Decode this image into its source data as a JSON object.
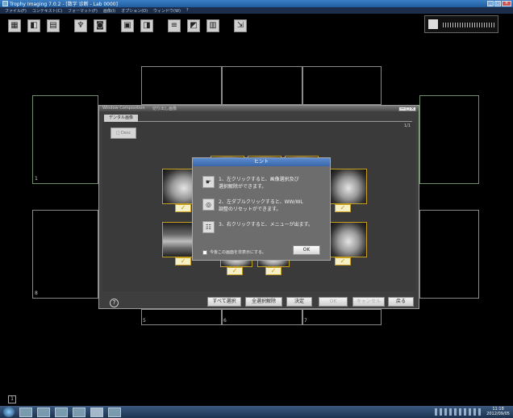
{
  "window": {
    "title": "Trophy Imaging 7.0.2 - [数字 诊断 - Lab 0000]",
    "controls": [
      "_",
      "□",
      "×"
    ]
  },
  "menu": [
    "ファイル(F)",
    "コンテキスト(C)",
    "フォーマット(F)",
    "画像(I)",
    "オプション(O)",
    "ウィンドウ(W)",
    "?"
  ],
  "toolbar_icons": [
    "layout-icon",
    "patient-icon",
    "folder-icon",
    "tooth-icon",
    "camera-icon",
    "xray-icon",
    "import-icon",
    "chart-icon",
    "export-icon",
    "save-icon",
    "exit-icon"
  ],
  "frames": [
    {
      "num": "1"
    },
    {
      "num": "8"
    },
    {
      "num": "5"
    },
    {
      "num": "6"
    },
    {
      "num": "7"
    }
  ],
  "dialog": {
    "title": "Window Composition",
    "title_right": "切り出し画像",
    "close_label": "— □ ×",
    "tab": "デンタル画像",
    "page": "1/1",
    "vdesc_label": "□ Desc",
    "help": "?",
    "buttons": {
      "select_all": "すべて選択",
      "deselect_all": "全選択解除",
      "decide": "決定",
      "ok": "OK",
      "cancel": "キャンセル",
      "back": "戻る"
    }
  },
  "hint": {
    "title": "ヒント",
    "rows": [
      {
        "icon": "click-icon",
        "glyph": "☛",
        "line1": "1、左クリックすると、画像選択及び",
        "line2": "選択解除ができます。"
      },
      {
        "icon": "double-click-icon",
        "glyph": "◎",
        "line1": "2、左ダブルクリックすると、WW/WL",
        "line2": "調整のリセットができます。"
      },
      {
        "icon": "menu-icon",
        "glyph": "☷",
        "line1": "3、右クリックすると、メニューが出ます。",
        "line2": ""
      }
    ],
    "checkbox_label": "今後この画面を非表示にする。",
    "ok": "OK"
  },
  "corner_label": "1",
  "clock": {
    "time": "11:18",
    "date": "2012/09/05"
  }
}
